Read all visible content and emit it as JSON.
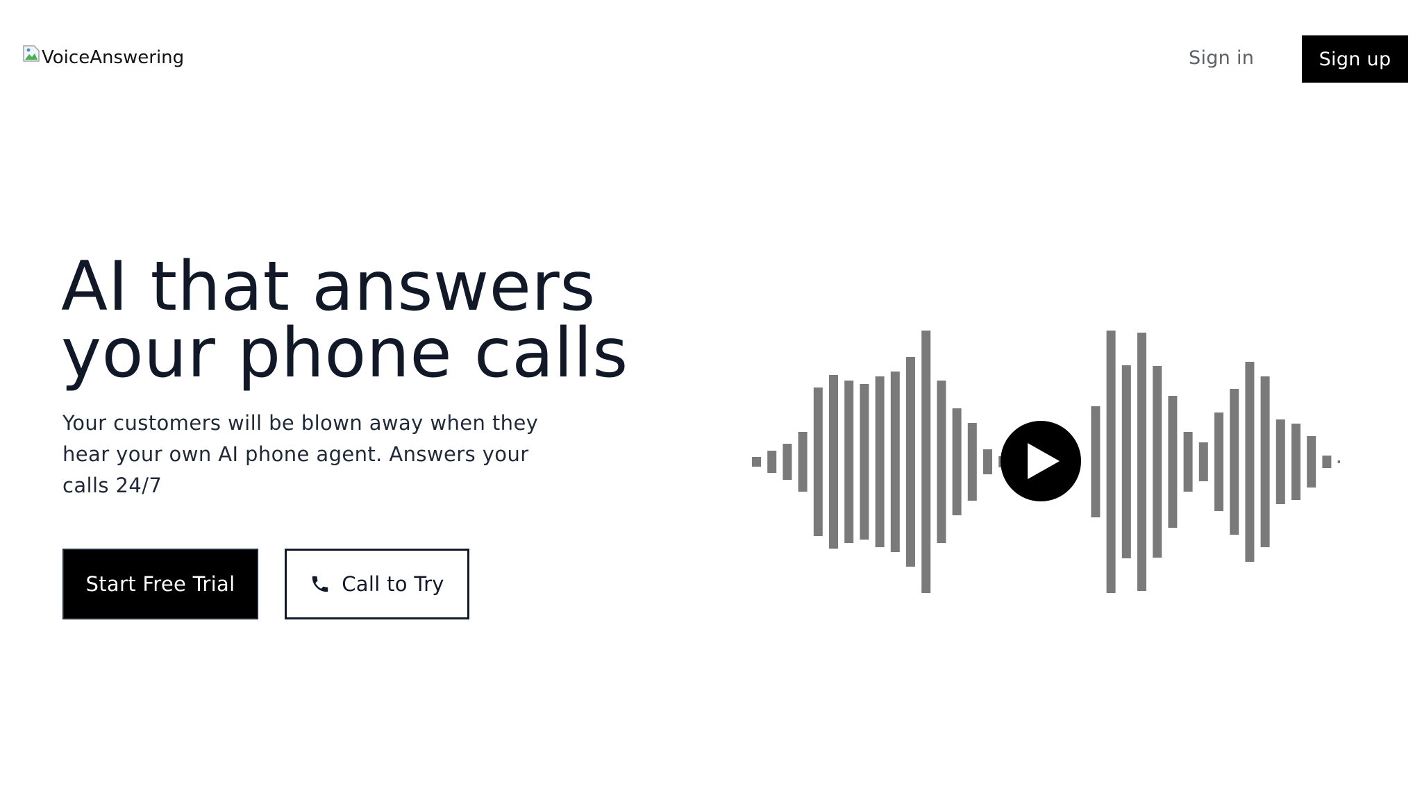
{
  "header": {
    "logo_alt": "VoiceAnswering",
    "signin_label": "Sign in",
    "signup_label": "Sign up"
  },
  "hero": {
    "title_line1": "AI that answers",
    "title_line2": "your phone calls",
    "subtitle": "Your customers will be blown away when they hear your own AI phone agent. Answers your calls 24/7",
    "trial_button_label": "Start Free Trial",
    "call_button_label": "Call to Try"
  },
  "icons": {
    "phone": "phone-icon",
    "play": "play-icon",
    "broken_image": "broken-image-icon"
  },
  "colors": {
    "primary": "#000000",
    "text": "#111827",
    "muted": "#5b5f66",
    "waveform": "#7a7a7a",
    "background": "#ffffff"
  }
}
